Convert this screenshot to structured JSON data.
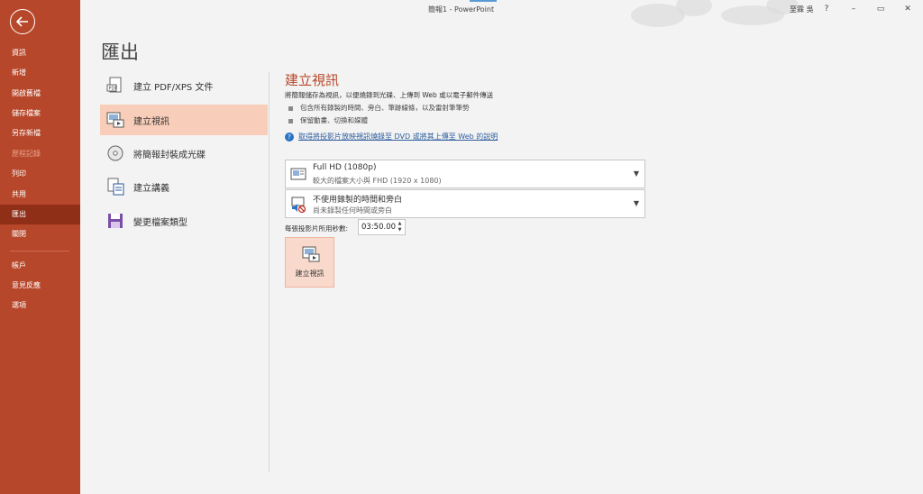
{
  "window": {
    "title": "簡報1 - PowerPoint",
    "user": "至霖 吳",
    "help_btn": "?",
    "minimize_btn": "–",
    "restore_btn": "▭",
    "close_btn": "✕"
  },
  "sidebar": {
    "items": [
      {
        "label": "資訊"
      },
      {
        "label": "新增"
      },
      {
        "label": "開啟舊檔"
      },
      {
        "label": "儲存檔案"
      },
      {
        "label": "另存新檔"
      },
      {
        "label": "歷程記錄"
      },
      {
        "label": "列印"
      },
      {
        "label": "共用"
      },
      {
        "label": "匯出"
      },
      {
        "label": "關閉"
      },
      {
        "label": "帳戶"
      },
      {
        "label": "意見反應"
      },
      {
        "label": "選項"
      }
    ]
  },
  "page": {
    "title": "匯出"
  },
  "export_options": [
    {
      "label": "建立 PDF/XPS 文件"
    },
    {
      "label": "建立視訊"
    },
    {
      "label": "將簡報封裝成光碟"
    },
    {
      "label": "建立講義"
    },
    {
      "label": "變更檔案類型"
    }
  ],
  "video": {
    "title": "建立視訊",
    "description": "將簡報儲存為視訊，以便燒錄到光碟、上傳到 Web 或以電子郵件傳送",
    "bullets": [
      "包含所有錄製的時間、旁白、筆跡線條，以及雷射筆筆勢",
      "保留動畫、切換和媒體"
    ],
    "help_link": "取得將投影片放映視訊燒錄至 DVD 或將其上傳至 Web 的說明",
    "quality": {
      "main": "Full HD (1080p)",
      "sub": "較大的檔案大小與 FHD (1920 x 1080)"
    },
    "timing": {
      "main": "不使用錄製的時間和旁白",
      "sub": "尚未錄製任何時間或旁白"
    },
    "seconds_label": "每張投影片所用秒數:",
    "seconds_value": "03:50.00",
    "create_button": "建立視訊"
  },
  "colors": {
    "accent": "#b7472a",
    "sidebar_active": "#8f2f18",
    "option_selected": "#f8cdb9",
    "link": "#2e5e9e"
  }
}
